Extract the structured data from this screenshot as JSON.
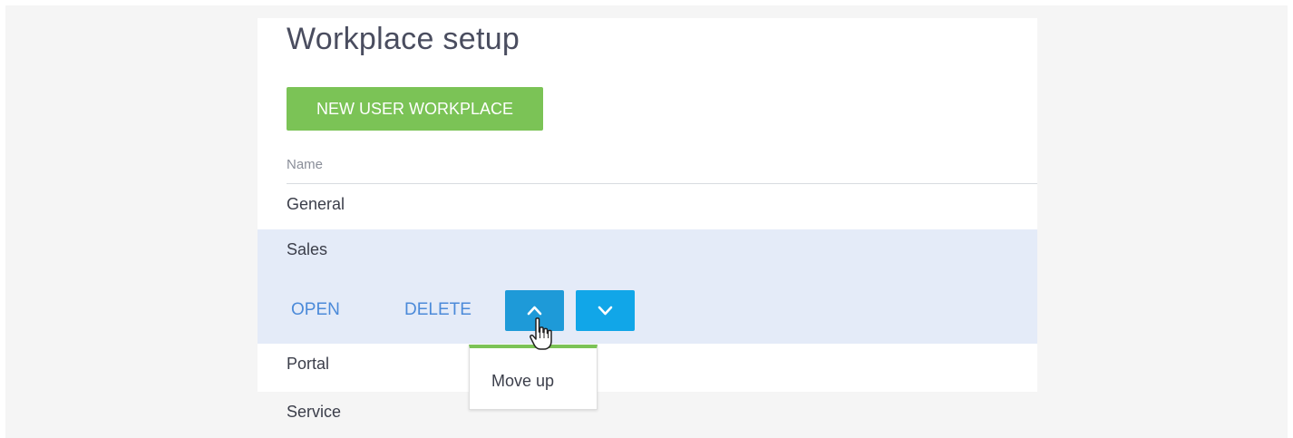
{
  "page": {
    "title": "Workplace setup"
  },
  "toolbar": {
    "new_button_label": "NEW USER WORKPLACE"
  },
  "table": {
    "column_header": "Name",
    "rows": [
      {
        "label": "General"
      },
      {
        "label": "Sales",
        "selected": true
      },
      {
        "label": "Portal"
      },
      {
        "label": "Service"
      }
    ]
  },
  "row_actions": {
    "open_label": "OPEN",
    "delete_label": "DELETE",
    "move_up_icon": "chevron-up-icon",
    "move_down_icon": "chevron-down-icon"
  },
  "tooltip": {
    "text": "Move up"
  },
  "colors": {
    "primary_green": "#7bc356",
    "selected_row": "#e4ebf8",
    "link_blue": "#4b8ad9",
    "move_up_button": "#1e9ad8",
    "move_down_button": "#11a6e8"
  }
}
